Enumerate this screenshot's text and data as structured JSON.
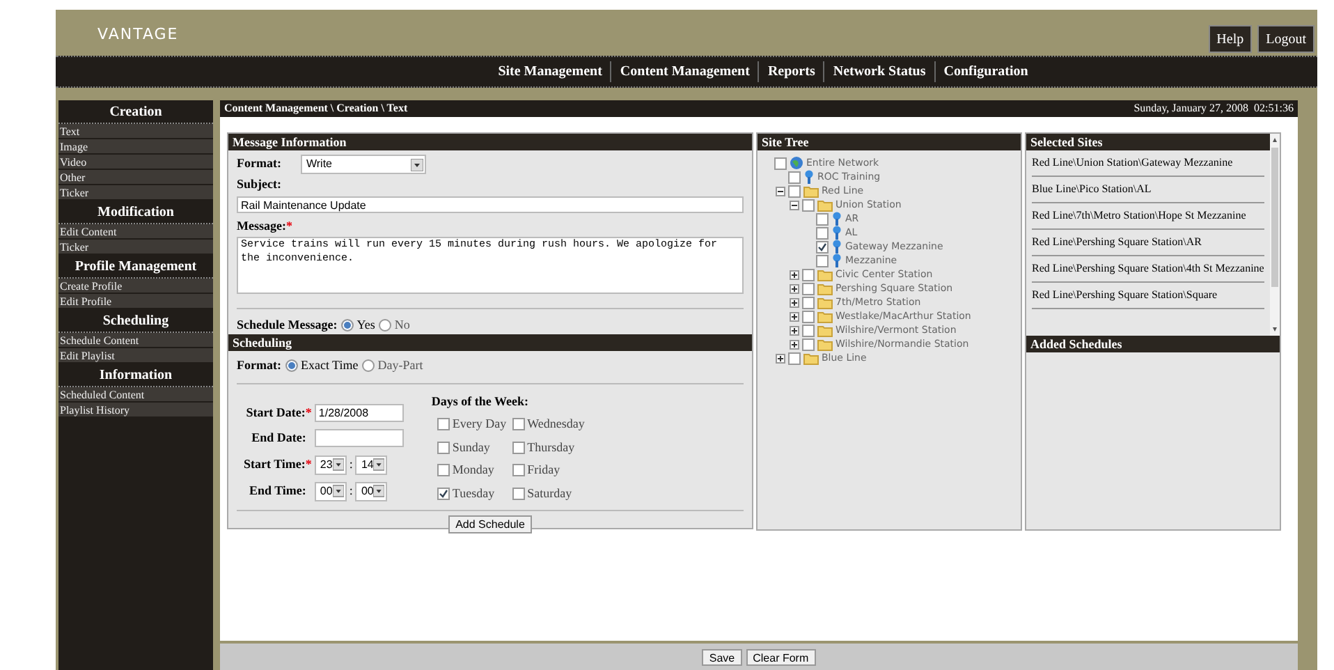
{
  "header": {
    "logo": "VANTAGE",
    "buttons": [
      "Help",
      "Logout"
    ]
  },
  "nav": [
    "Site Management",
    "Content Management",
    "Reports",
    "Network Status",
    "Configuration"
  ],
  "sidebar": [
    {
      "title": "Creation",
      "items": [
        "Text",
        "Image",
        "Video",
        "Other",
        "Ticker"
      ]
    },
    {
      "title": "Modification",
      "items": [
        "Edit Content",
        "Ticker"
      ]
    },
    {
      "title": "Profile Management",
      "items": [
        "Create Profile",
        "Edit Profile"
      ]
    },
    {
      "title": "Scheduling",
      "items": [
        "Schedule Content",
        "Edit Playlist"
      ]
    },
    {
      "title": "Information",
      "items": [
        "Scheduled Content",
        "Playlist History"
      ]
    }
  ],
  "breadcrumb": "Content Management \\ Creation \\ Text",
  "datetime": "Sunday, January 27, 2008  02:51:36",
  "message_panel": {
    "title": "Message Information",
    "format_label": "Format:",
    "format_value": "Write",
    "subject_label": "Subject:",
    "subject_value": "Rail Maintenance Update",
    "message_label": "Message:",
    "required_mark": "*",
    "message_value": "Service trains will run every 15 minutes during rush hours. We apologize for the inconvenience.",
    "schedule_label": "Schedule Message:",
    "schedule_options": [
      {
        "label": "Yes",
        "selected": true
      },
      {
        "label": "No",
        "selected": false
      }
    ]
  },
  "scheduling": {
    "title": "Scheduling",
    "format_label": "Format:",
    "format_options": [
      {
        "label": "Exact Time",
        "selected": true
      },
      {
        "label": "Day-Part",
        "selected": false
      }
    ],
    "start_date_label": "Start Date:",
    "start_date": "1/28/2008",
    "end_date_label": "End Date:",
    "start_time_label": "Start Time:",
    "start_time": [
      "23",
      "14"
    ],
    "end_time_label": "End Time:",
    "end_time": [
      "00",
      "00"
    ],
    "time_separator": ":",
    "required_mark": "*",
    "days_title": "Days of the Week:",
    "days": [
      {
        "label": "Every Day",
        "checked": false
      },
      {
        "label": "Wednesday",
        "checked": false
      },
      {
        "label": "Sunday",
        "checked": false
      },
      {
        "label": "Thursday",
        "checked": false
      },
      {
        "label": "Monday",
        "checked": false
      },
      {
        "label": "Friday",
        "checked": false
      },
      {
        "label": "Tuesday",
        "checked": true
      },
      {
        "label": "Saturday",
        "checked": false
      }
    ],
    "add_button": "Add Schedule"
  },
  "site_tree": {
    "title": "Site Tree",
    "nodes": [
      {
        "label": "Entire Network",
        "kind": "globe",
        "checked": false,
        "children": [
          {
            "label": "ROC Training",
            "kind": "pin",
            "checked": false
          },
          {
            "label": "Red Line",
            "kind": "folder",
            "checked": false,
            "expanded": true,
            "children": [
              {
                "label": "Union Station",
                "kind": "folder",
                "checked": false,
                "expanded": true,
                "children": [
                  {
                    "label": "AR",
                    "kind": "pin",
                    "checked": false
                  },
                  {
                    "label": "AL",
                    "kind": "pin",
                    "checked": false
                  },
                  {
                    "label": "Gateway Mezzanine",
                    "kind": "pin",
                    "checked": true
                  },
                  {
                    "label": "Mezzanine",
                    "kind": "pin",
                    "checked": false
                  }
                ]
              },
              {
                "label": "Civic Center Station",
                "kind": "folder",
                "checked": false,
                "expanded": false
              },
              {
                "label": "Pershing Square Station",
                "kind": "folder",
                "checked": false,
                "expanded": false
              },
              {
                "label": "7th/Metro Station",
                "kind": "folder",
                "checked": false,
                "expanded": false
              },
              {
                "label": "Westlake/MacArthur Station",
                "kind": "folder",
                "checked": false,
                "expanded": false
              },
              {
                "label": "Wilshire/Vermont Station",
                "kind": "folder",
                "checked": false,
                "expanded": false
              },
              {
                "label": "Wilshire/Normandie Station",
                "kind": "folder",
                "checked": false,
                "expanded": false
              }
            ]
          },
          {
            "label": "Blue Line",
            "kind": "folder",
            "checked": false,
            "expanded": false
          }
        ]
      }
    ]
  },
  "selected_sites": {
    "title": "Selected Sites",
    "items": [
      "Red Line\\Union Station\\Gateway Mezzanine",
      "Blue Line\\Pico Station\\AL",
      "Red Line\\7th\\Metro Station\\Hope St Mezzanine",
      "Red Line\\Pershing Square Station\\AR",
      "Red Line\\Pershing Square Station\\4th St Mezzanine",
      "Red Line\\Pershing Square Station\\Square"
    ]
  },
  "added_schedules": {
    "title": "Added Schedules"
  },
  "footer_buttons": [
    "Save",
    "Clear Form"
  ]
}
